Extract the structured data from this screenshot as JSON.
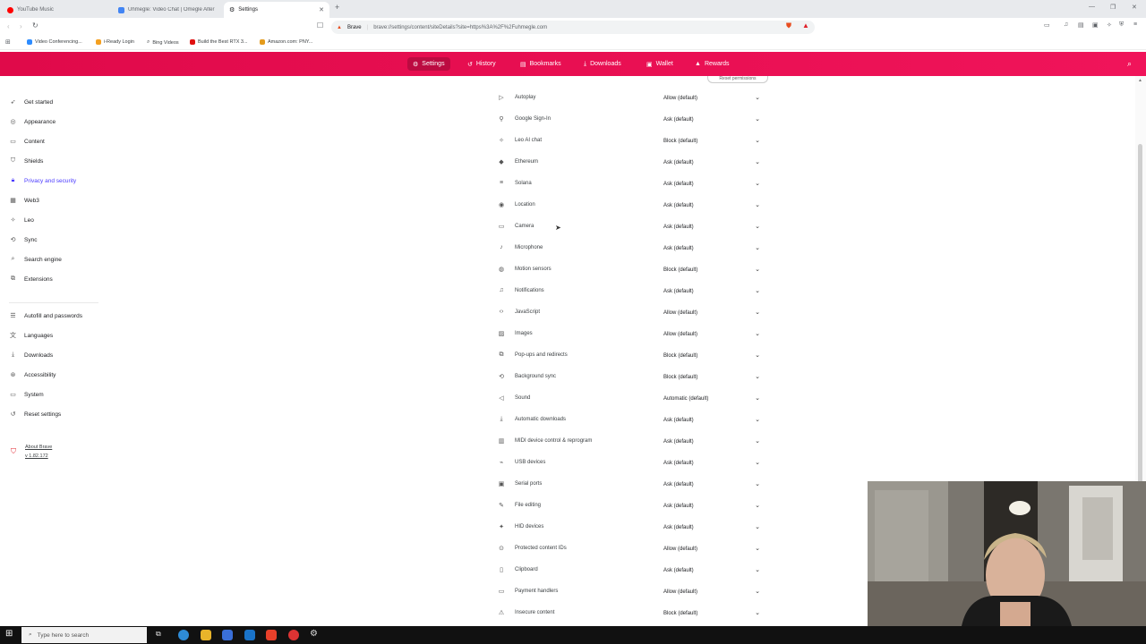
{
  "browser": {
    "tabs": [
      {
        "title": "YouTube Music",
        "color": "#ff0000"
      },
      {
        "title": "Uhmegle: Video Chat | Omegle Alter",
        "color": "#4285f4"
      },
      {
        "title": "Settings",
        "color": "#888888"
      }
    ],
    "new_tab_label": "+",
    "omnibox": {
      "brand": "Brave",
      "url": "brave://settings/content/siteDetails?site=https%3A%2F%2Fuhmegle.com"
    },
    "bookmarks": [
      {
        "label": "Video Conferencing...",
        "color": "#2d8cff"
      },
      {
        "label": "i-Ready Login",
        "color": "#f4a020"
      },
      {
        "label": "Bing Videos",
        "color": "#555555"
      },
      {
        "label": "Build the Best RTX 3...",
        "color": "#e01010"
      },
      {
        "label": "Amazon.com: PNY...",
        "color": "#e49b1b"
      }
    ]
  },
  "header": {
    "nav": [
      {
        "label": "Settings",
        "icon": "gear-icon"
      },
      {
        "label": "History",
        "icon": "history-icon"
      },
      {
        "label": "Bookmarks",
        "icon": "bookmark-icon"
      },
      {
        "label": "Downloads",
        "icon": "download-icon"
      },
      {
        "label": "Wallet",
        "icon": "wallet-icon"
      },
      {
        "label": "Rewards",
        "icon": "rewards-icon"
      }
    ],
    "accent": "#e80a50"
  },
  "sidebar": {
    "items": [
      {
        "label": "Get started",
        "icon": "rocket-icon"
      },
      {
        "label": "Appearance",
        "icon": "palette-icon"
      },
      {
        "label": "Content",
        "icon": "content-icon"
      },
      {
        "label": "Shields",
        "icon": "shield-icon"
      },
      {
        "label": "Privacy and security",
        "icon": "lock-icon"
      },
      {
        "label": "Web3",
        "icon": "web3-icon"
      },
      {
        "label": "Leo",
        "icon": "leo-icon"
      },
      {
        "label": "Sync",
        "icon": "sync-icon"
      },
      {
        "label": "Search engine",
        "icon": "search-icon"
      },
      {
        "label": "Extensions",
        "icon": "puzzle-icon"
      }
    ],
    "items2": [
      {
        "label": "Autofill and passwords",
        "icon": "autofill-icon"
      },
      {
        "label": "Languages",
        "icon": "translate-icon"
      },
      {
        "label": "Downloads",
        "icon": "download-icon"
      },
      {
        "label": "Accessibility",
        "icon": "accessibility-icon"
      },
      {
        "label": "System",
        "icon": "system-icon"
      },
      {
        "label": "Reset settings",
        "icon": "reset-icon"
      }
    ],
    "about_label": "About Brave",
    "version": "v 1.82.172",
    "active_color": "#4a3aff"
  },
  "permissions": {
    "reset_label": "Reset permissions",
    "rows": [
      {
        "label": "Autoplay",
        "value": "Allow (default)",
        "icon": "autoplay-icon"
      },
      {
        "label": "Google Sign-In",
        "value": "Ask (default)",
        "icon": "person-icon"
      },
      {
        "label": "Leo AI chat",
        "value": "Block (default)",
        "icon": "leo-icon"
      },
      {
        "label": "Ethereum",
        "value": "Ask (default)",
        "icon": "ethereum-icon"
      },
      {
        "label": "Solana",
        "value": "Ask (default)",
        "icon": "solana-icon"
      },
      {
        "label": "Location",
        "value": "Ask (default)",
        "icon": "location-icon"
      },
      {
        "label": "Camera",
        "value": "Ask (default)",
        "icon": "camera-icon"
      },
      {
        "label": "Microphone",
        "value": "Ask (default)",
        "icon": "microphone-icon"
      },
      {
        "label": "Motion sensors",
        "value": "Block (default)",
        "icon": "sensors-icon"
      },
      {
        "label": "Notifications",
        "value": "Ask (default)",
        "icon": "bell-icon"
      },
      {
        "label": "JavaScript",
        "value": "Allow (default)",
        "icon": "code-icon"
      },
      {
        "label": "Images",
        "value": "Allow (default)",
        "icon": "image-icon"
      },
      {
        "label": "Pop-ups and redirects",
        "value": "Block (default)",
        "icon": "popup-icon"
      },
      {
        "label": "Background sync",
        "value": "Block (default)",
        "icon": "sync-icon"
      },
      {
        "label": "Sound",
        "value": "Automatic (default)",
        "icon": "sound-icon"
      },
      {
        "label": "Automatic downloads",
        "value": "Ask (default)",
        "icon": "download-icon"
      },
      {
        "label": "MIDI device control & reprogram",
        "value": "Ask (default)",
        "icon": "midi-icon"
      },
      {
        "label": "USB devices",
        "value": "Ask (default)",
        "icon": "usb-icon"
      },
      {
        "label": "Serial ports",
        "value": "Ask (default)",
        "icon": "serial-icon"
      },
      {
        "label": "File editing",
        "value": "Ask (default)",
        "icon": "file-edit-icon"
      },
      {
        "label": "HID devices",
        "value": "Ask (default)",
        "icon": "hid-icon"
      },
      {
        "label": "Protected content IDs",
        "value": "Allow (default)",
        "icon": "protected-icon"
      },
      {
        "label": "Clipboard",
        "value": "Ask (default)",
        "icon": "clipboard-icon"
      },
      {
        "label": "Payment handlers",
        "value": "Allow (default)",
        "icon": "payment-icon"
      },
      {
        "label": "Insecure content",
        "value": "Block (default)",
        "icon": "warning-icon"
      }
    ]
  },
  "taskbar": {
    "search_placeholder": "Type here to search"
  }
}
